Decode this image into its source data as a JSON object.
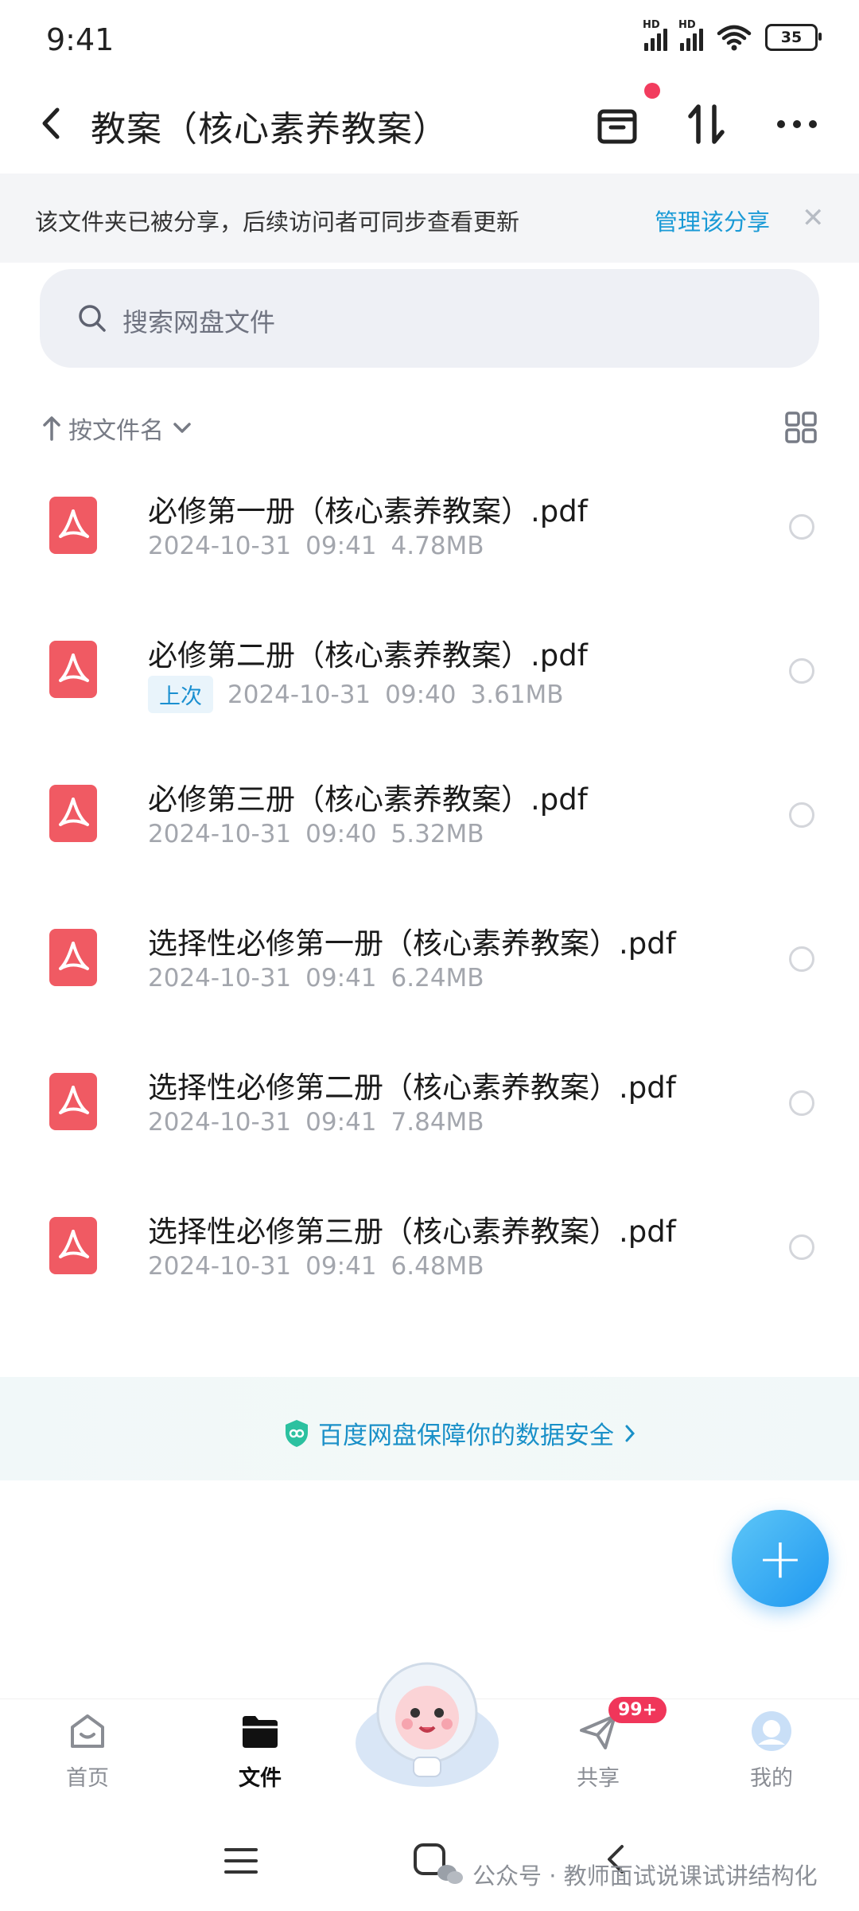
{
  "status_bar": {
    "time": "9:41",
    "signal1": "HD",
    "signal2": "HD",
    "battery": "35"
  },
  "header": {
    "title": "教案（核心素养教案）"
  },
  "share_banner": {
    "text": "该文件夹已被分享，后续访问者可同步查看更新",
    "link": "管理该分享"
  },
  "search": {
    "placeholder": "搜索网盘文件"
  },
  "sort": {
    "label": "按文件名"
  },
  "files": [
    {
      "name": "必修第一册（核心素养教案）.pdf",
      "date": "2024-10-31",
      "time": "09:41",
      "size": "4.78MB"
    },
    {
      "name": "必修第二册（核心素养教案）.pdf",
      "badge": "上次",
      "date": "2024-10-31",
      "time": "09:40",
      "size": "3.61MB"
    },
    {
      "name": "必修第三册（核心素养教案）.pdf",
      "date": "2024-10-31",
      "time": "09:40",
      "size": "5.32MB"
    },
    {
      "name": "选择性必修第一册（核心素养教案）.pdf",
      "date": "2024-10-31",
      "time": "09:41",
      "size": "6.24MB"
    },
    {
      "name": "选择性必修第二册（核心素养教案）.pdf",
      "date": "2024-10-31",
      "time": "09:41",
      "size": "7.84MB"
    },
    {
      "name": "选择性必修第三册（核心素养教案）.pdf",
      "date": "2024-10-31",
      "time": "09:41",
      "size": "6.48MB"
    }
  ],
  "safety": {
    "text": "百度网盘保障你的数据安全"
  },
  "nav": {
    "home": "首页",
    "files": "文件",
    "share": "共享",
    "share_badge": "99+",
    "me": "我的"
  },
  "watermark": {
    "text": "公众号 · 教师面试说课试讲结构化"
  },
  "colors": {
    "accent": "#1a9ad6",
    "pdf": "#f05a63",
    "badge": "#f0365a"
  }
}
